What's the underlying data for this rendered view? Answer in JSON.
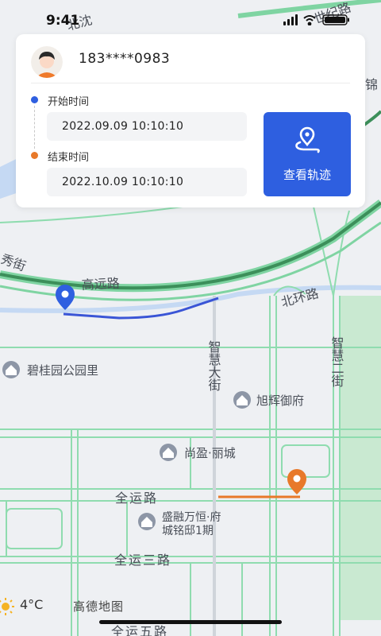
{
  "status_bar": {
    "time": "9:41"
  },
  "card": {
    "phone": "183****0983",
    "start_label": "开始时间",
    "start_time": "2022.09.09   10:10:10",
    "end_label": "结束时间",
    "end_time": "2022.10.09   10:10:10",
    "track_button_label": "查看轨迹"
  },
  "map": {
    "roads": {
      "gaoyuan": "高远路",
      "beihuan": "北环路",
      "zhihui_da": "智慧大街",
      "zhihui_er": "智慧二街",
      "quanyun": "全运路",
      "quanyun_san": "全运三路",
      "quanyun_wu": "全运五路",
      "xiu_jie": "秀街",
      "shiji": "世纪路",
      "jin": "锦",
      "top_partial": "北沈"
    },
    "pois": [
      {
        "name": "碧桂园公园里"
      },
      {
        "name": "旭辉御府"
      },
      {
        "name": "尚盈·丽城"
      },
      {
        "name": "盛融万恒·府",
        "sub": "城铭邸1期"
      }
    ]
  },
  "colors": {
    "accent": "#2e5fe0",
    "start_dot": "#2f5fe0",
    "end_marker": "#e8792a",
    "main_road": "#3c8f5a",
    "road_outline": "#7fd4a2",
    "water": "#c5d9f3",
    "greenery": "#c9e9d1"
  },
  "footer": {
    "temperature": "4°C",
    "brand": "高德地图"
  },
  "icons": [
    "avatar",
    "route-pin-icon",
    "start-pin-icon",
    "end-pin-icon",
    "poi-house-icon",
    "sun-icon",
    "signal-icon",
    "wifi-icon",
    "battery-icon"
  ]
}
